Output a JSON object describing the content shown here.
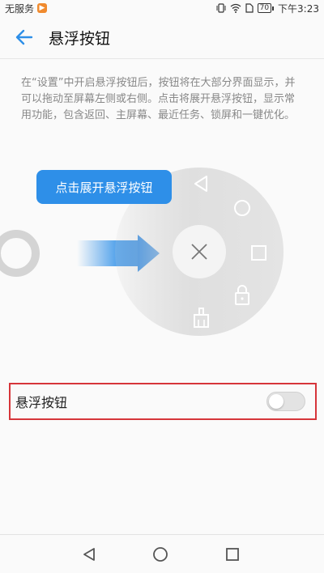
{
  "status_bar": {
    "carrier": "无服务",
    "carrier_badge_icon": "notification-app-icon",
    "battery": "70",
    "time": "下午3:23",
    "icons": [
      "vibrate-icon",
      "wifi-icon",
      "sim-icon",
      "battery-icon"
    ]
  },
  "header": {
    "back_icon": "arrow-left-icon",
    "title": "悬浮按钮"
  },
  "description": "在“设置”中开启悬浮按钮后，按钮将在大部分界面显示，并可以拖动至屏幕左侧或右侧。点击将展开悬浮按钮，显示常用功能，包含返回、主屏幕、最近任务、锁屏和一键优化。",
  "illustration": {
    "hint_label": "点击展开悬浮按钮",
    "menu_icons": [
      "back-triangle-icon",
      "home-circle-icon",
      "recent-square-icon",
      "lock-icon",
      "broom-icon",
      "close-icon"
    ],
    "accent_color": "#2e8fe8"
  },
  "setting": {
    "label": "悬浮按钮",
    "enabled": false
  },
  "nav_bar": {
    "icons": [
      "nav-back-icon",
      "nav-home-icon",
      "nav-recent-icon"
    ]
  }
}
